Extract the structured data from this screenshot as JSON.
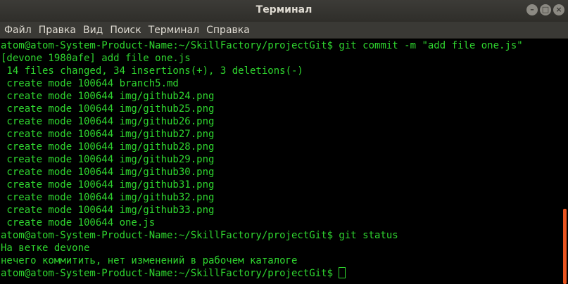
{
  "window": {
    "title": "Терминал",
    "minimize_glyph": "–",
    "maximize_glyph": "□",
    "close_glyph": "×"
  },
  "menu": {
    "items": [
      {
        "label": "Файл"
      },
      {
        "label": "Правка"
      },
      {
        "label": "Вид"
      },
      {
        "label": "Поиск"
      },
      {
        "label": "Терминал"
      },
      {
        "label": "Справка"
      }
    ]
  },
  "terminal": {
    "lines": [
      "atom@atom-System-Product-Name:~/SkillFactory/projectGit$ git commit -m \"add file one.js\"",
      "[devone 1980afe] add file one.js",
      " 14 files changed, 34 insertions(+), 3 deletions(-)",
      " create mode 100644 branch5.md",
      " create mode 100644 img/github24.png",
      " create mode 100644 img/github25.png",
      " create mode 100644 img/github26.png",
      " create mode 100644 img/github27.png",
      " create mode 100644 img/github28.png",
      " create mode 100644 img/github29.png",
      " create mode 100644 img/github30.png",
      " create mode 100644 img/github31.png",
      " create mode 100644 img/github32.png",
      " create mode 100644 img/github33.png",
      " create mode 100644 one.js",
      "atom@atom-System-Product-Name:~/SkillFactory/projectGit$ git status",
      "На ветке devone",
      "нечего коммитить, нет изменений в рабочем каталоге"
    ],
    "prompt": "atom@atom-System-Product-Name:~/SkillFactory/projectGit$ "
  },
  "colors": {
    "terminal_text": "#2fd62f",
    "terminal_bg": "#000000",
    "titlebar_bg": "#3c3b37",
    "scrollbar_thumb": "#e95420"
  },
  "icons": {
    "minimize": "minimize-icon",
    "maximize": "maximize-icon",
    "close": "close-icon"
  }
}
